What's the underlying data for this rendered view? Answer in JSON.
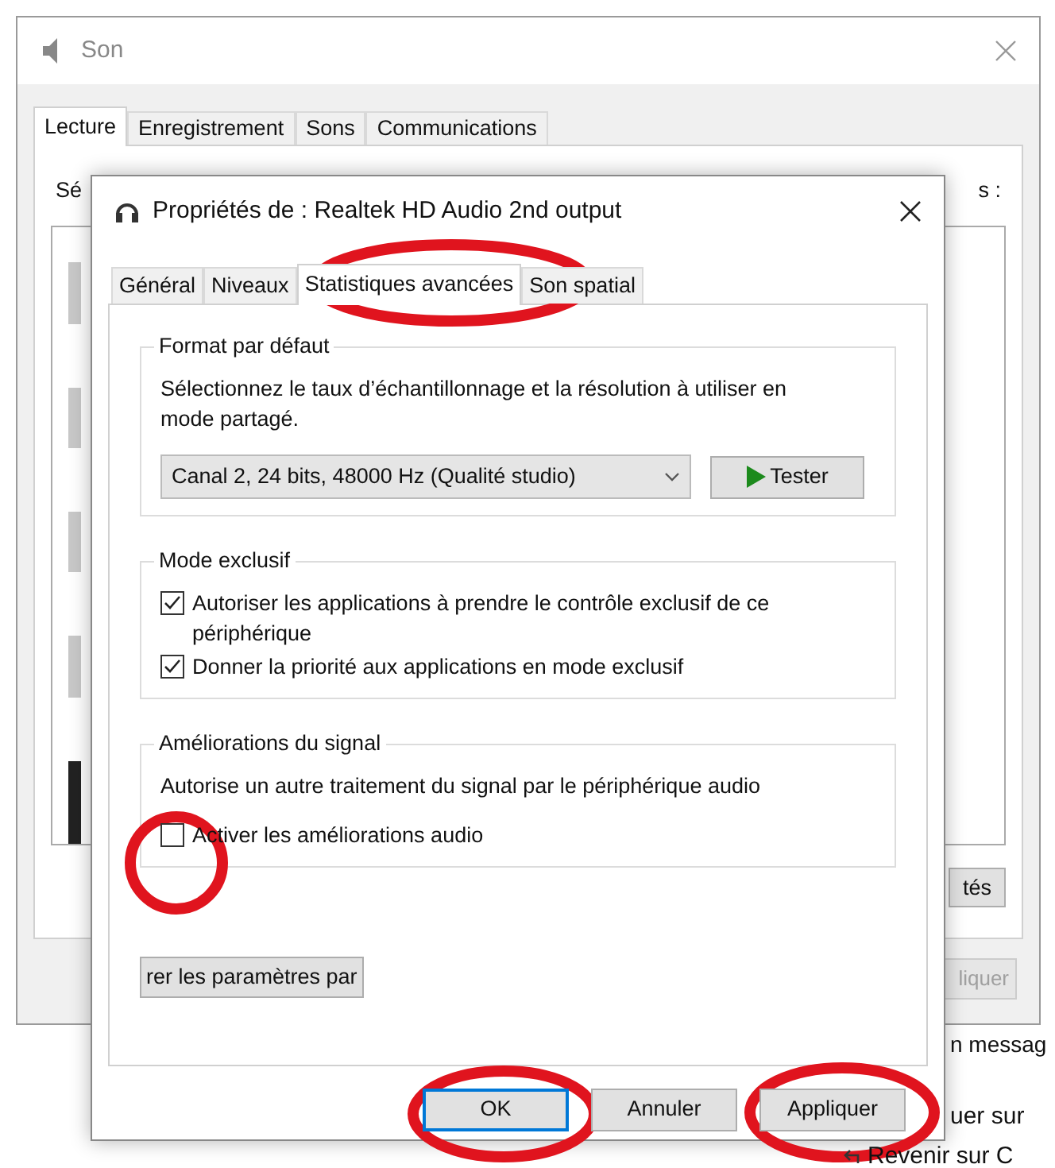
{
  "window": {
    "title": "Son"
  },
  "tabs": [
    {
      "label": "Lecture",
      "selected": true
    },
    {
      "label": "Enregistrement",
      "selected": false
    },
    {
      "label": "Sons",
      "selected": false
    },
    {
      "label": "Communications",
      "selected": false
    }
  ],
  "background_text": {
    "left": "Sé",
    "right": "s :"
  },
  "background_buttons": [
    {
      "label": "tés",
      "disabled": false
    },
    {
      "label": "liquer",
      "disabled": true
    }
  ],
  "dialog": {
    "title": "Propriétés de : Realtek HD Audio 2nd output",
    "tabs": [
      {
        "label": "Général",
        "selected": false
      },
      {
        "label": "Niveaux",
        "selected": false
      },
      {
        "label": "Statistiques avancées",
        "selected": true
      },
      {
        "label": "Son spatial",
        "selected": false
      }
    ],
    "format_group": {
      "title": "Format par défaut",
      "description": "Sélectionnez le taux d’échantillonnage et la résolution à utiliser en mode partagé.",
      "format_select": "Canal 2, 24 bits, 48000 Hz (Qualité studio)",
      "test_button": "Tester"
    },
    "exclusive_group": {
      "title": "Mode exclusif",
      "options": [
        {
          "label": "Autoriser les applications à prendre le contrôle exclusif de ce périphérique",
          "checked": true
        },
        {
          "label": "Donner la priorité aux applications en mode exclusif",
          "checked": true
        }
      ]
    },
    "enhancements_group": {
      "title": "Améliorations du signal",
      "description": "Autorise un autre traitement du signal par le périphérique audio",
      "options": [
        {
          "label": "Activer les améliorations audio",
          "checked": false
        }
      ]
    },
    "restore_button": "rer les paramètres par",
    "buttons": [
      {
        "label": "OK",
        "default": true
      },
      {
        "label": "Annuler",
        "default": false
      },
      {
        "label": "Appliquer",
        "default": false
      }
    ]
  },
  "page_text": [
    "n messag",
    "uer sur",
    "Revenir sur C"
  ]
}
